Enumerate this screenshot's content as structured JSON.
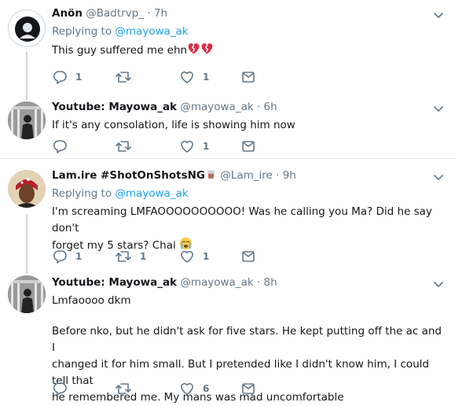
{
  "tweets": [
    {
      "name": "Anön",
      "handle": "@Badtrvp_",
      "time": "7h",
      "replying_prefix": "Replying to",
      "replying_to": "@mayowa_ak",
      "text": "This guy suffered me ehn",
      "text_emoji": "broken-heart x2",
      "counts": {
        "reply": "1",
        "retweet": "",
        "like": "1"
      }
    },
    {
      "name": "Youtube: Mayowa_ak",
      "handle": "@mayowa_ak",
      "time": "6h",
      "text": "If it's any consolation, life is showing him now",
      "counts": {
        "reply": "",
        "retweet": "",
        "like": "1"
      }
    },
    {
      "name": "Lam.ire #ShotOnShotsNG",
      "name_emoji": "tumbler-glass",
      "handle": "@Lam_ire",
      "time": "9h",
      "replying_prefix": "Replying to",
      "replying_to": "@mayowa_ak",
      "text_line1": "I'm screaming LMFAOOOOOOOOOO! Was he calling you Ma? Did he say don't",
      "text_line2": "forget my 5 stars? Chai",
      "text_emoji": "crying-face",
      "counts": {
        "reply": "1",
        "retweet": "1",
        "like": "1"
      }
    },
    {
      "name": "Youtube: Mayowa_ak",
      "handle": "@mayowa_ak",
      "time": "8h",
      "text_line1": "Lmfaoooo dkm",
      "para_line1": "Before nko, but he didn't ask for five stars. He kept putting off the ac and I",
      "para_line2": "changed it for him small. But I pretended like I didn't know him, I could tell that",
      "para_line3": "he remembered me. My mans was mad uncomfortable",
      "counts": {
        "reply": "",
        "retweet": "",
        "like": "6"
      }
    }
  ],
  "separator": "·",
  "colors": {
    "link": "#1da1f2",
    "muted": "#657786",
    "thread": "#ccd6dd",
    "divider": "#e6ecf0"
  }
}
